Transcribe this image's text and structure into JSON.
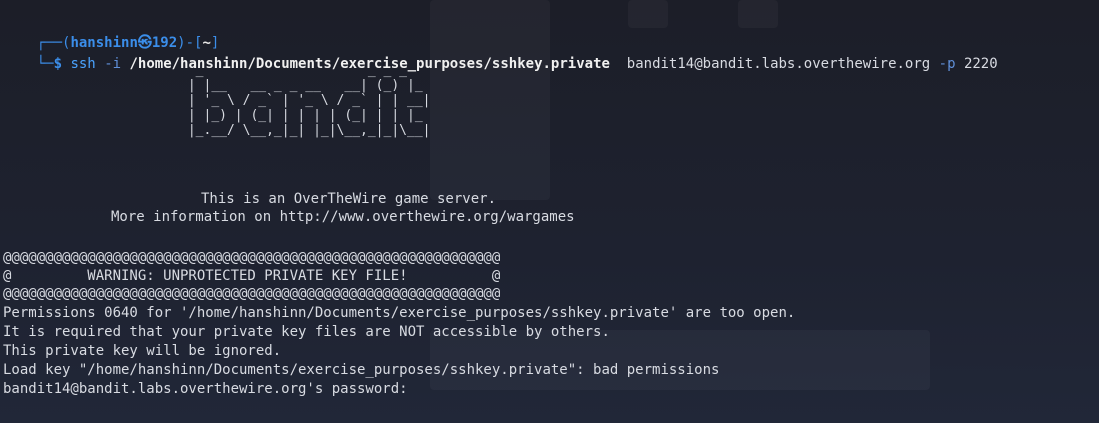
{
  "prompt": {
    "frame_top_left": "┌──(",
    "user_host": "hanshinn㉿192",
    "frame_mid": ")-[",
    "cwd": "~",
    "frame_close": "]",
    "frame_bottom": "└─",
    "dollar": "$"
  },
  "command": {
    "program": "ssh",
    "flag_i": "-i",
    "key_path": "/home/hanshinn/Documents/exercise_purposes/sshkey.private",
    "target": "bandit14@bandit.labs.overthewire.org",
    "flag_p": "-p",
    "port": "2220"
  },
  "banner": {
    "ascii_art": "                         _                     _ _ _\n                        | |__   __ _ _ __   __| (_) |_\n                        | '_ \\ / _` | '_ \\ / _` | | __|\n                        | |_) | (_| | | | | (_| | | |_\n                        |_.__/ \\__,_|_| |_|\\__,_|_|\\__|",
    "line1": "This is an OverTheWire game server.",
    "line2": "More information on http://www.overthewire.org/wargames"
  },
  "output": {
    "border_line": "@@@@@@@@@@@@@@@@@@@@@@@@@@@@@@@@@@@@@@@@@@@@@@@@@@@@@@@@@@@",
    "warning_line": "@         WARNING: UNPROTECTED PRIVATE KEY FILE!          @",
    "perm_line": "Permissions 0640 for '/home/hanshinn/Documents/exercise_purposes/sshkey.private' are too open.",
    "required_line": "It is required that your private key files are NOT accessible by others.",
    "ignored_line": "This private key will be ignored.",
    "load_key_line": "Load key \"/home/hanshinn/Documents/exercise_purposes/sshkey.private\": bad permissions",
    "password_prompt": "bandit14@bandit.labs.overthewire.org's password:"
  }
}
